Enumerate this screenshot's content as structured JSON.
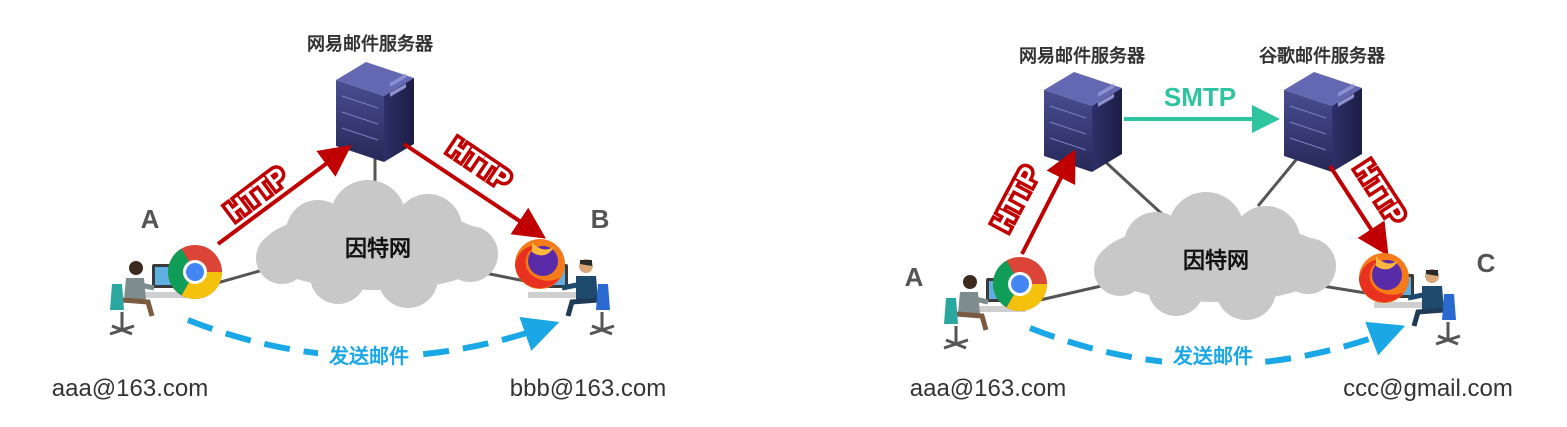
{
  "colors": {
    "http_arrow": "#c00000",
    "smtp_arrow": "#2ec4a0",
    "send_arrow": "#1aa7e6",
    "cloud": "#c8c8c8",
    "server": "#3c3f7a"
  },
  "left_diagram": {
    "server_label": "网易邮件服务器",
    "cloud_label": "因特网",
    "node_a": "A",
    "node_b": "B",
    "http_label_1": "HTTP",
    "http_label_2": "HTTP",
    "send_label": "发送邮件",
    "email_a": "aaa@163.com",
    "email_b": "bbb@163.com"
  },
  "right_diagram": {
    "server_label_1": "网易邮件服务器",
    "server_label_2": "谷歌邮件服务器",
    "smtp_label": "SMTP",
    "cloud_label": "因特网",
    "node_a": "A",
    "node_c": "C",
    "http_label_1": "HTTP",
    "http_label_2": "HTTP",
    "send_label": "发送邮件",
    "email_a": "aaa@163.com",
    "email_c": "ccc@gmail.com"
  }
}
